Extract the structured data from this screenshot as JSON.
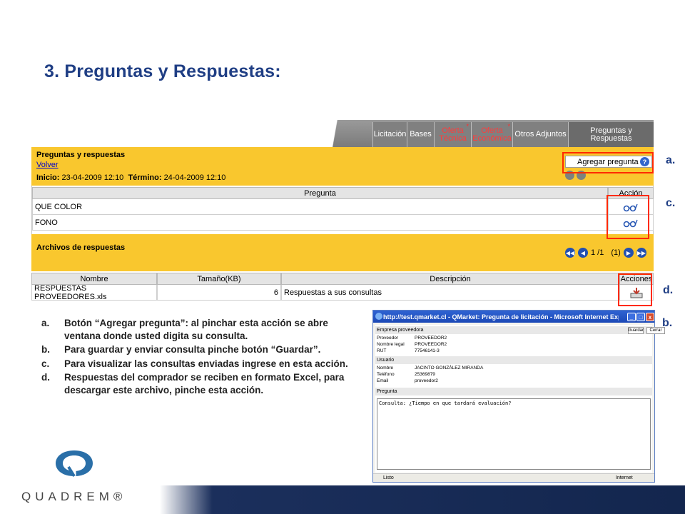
{
  "slide": {
    "title": "3.  Preguntas y Respuestas:"
  },
  "tabs": [
    {
      "label": "Licitación",
      "color": "white"
    },
    {
      "label": "Bases",
      "color": "white"
    },
    {
      "label": "Oferta Técnica",
      "color": "red"
    },
    {
      "label": "Oferta Económica",
      "color": "red"
    },
    {
      "label": "Otros Adjuntos",
      "color": "white"
    },
    {
      "label": "Preguntas y Respuestas",
      "color": "white"
    }
  ],
  "panel": {
    "title": "Preguntas y respuestas",
    "back_link": "Volver",
    "start_label": "Inicio:",
    "start_value": "23-04-2009 12:10",
    "end_label": "Término:",
    "end_value": "24-04-2009 12:10",
    "add_button": "Agregar pregunta",
    "help_icon": "?"
  },
  "questions_table": {
    "headers": [
      "Pregunta",
      "Acción"
    ],
    "rows": [
      {
        "question": "QUE COLOR"
      },
      {
        "question": "FONO"
      }
    ]
  },
  "files_panel": {
    "title": "Archivos de respuestas",
    "pager_text": "1 /1",
    "pager_count": "(1)"
  },
  "files_table": {
    "headers": [
      "Nombre",
      "Tamaño(KB)",
      "Descripción",
      "Acciones"
    ],
    "rows": [
      {
        "name": "RESPUESTAS PROVEEDORES.xls",
        "size": "6",
        "description": "Respuestas a sus consultas"
      }
    ]
  },
  "callouts": {
    "a": "a.",
    "c": "c.",
    "d": "d.",
    "b": "b."
  },
  "instructions": [
    {
      "label": "a.",
      "text": "Botón “Agregar pregunta”: al pinchar esta acción se abre ventana donde usted digita su consulta."
    },
    {
      "label": "b.",
      "text": "Para guardar y enviar consulta pinche botón “Guardar”."
    },
    {
      "label": "c.",
      "text": "Para visualizar las consultas enviadas ingrese en esta acción."
    },
    {
      "label": "d.",
      "text": "Respuestas del comprador se reciben en formato Excel, para descargar este archivo, pinche esta acción."
    }
  ],
  "popup": {
    "title": "http://test.qmarket.cl - QMarket: Pregunta de licitación - Microsoft Internet Explorer",
    "section_supplier": "Empresa proveedora",
    "guardar_button": "Guardar",
    "cerrar_button": "Cerrar",
    "supplier_rows": [
      {
        "key": "Proveedor",
        "value": "PROVEEDOR2"
      },
      {
        "key": "Nombre legal",
        "value": "PROVEEDOR2"
      },
      {
        "key": "RUT",
        "value": "77546141-3"
      }
    ],
    "section_user": "Usuario",
    "user_rows": [
      {
        "key": "Nombre",
        "value": "JACINTO GONZÁLEZ MIRANDA"
      },
      {
        "key": "Teléfono",
        "value": "25369879"
      },
      {
        "key": "Email",
        "value": "proveedor2"
      }
    ],
    "section_question": "Pregunta",
    "question_text": "Consulta: ¿Tiempo en que tardará evaluación?",
    "status_left": "Listo",
    "status_right": "Internet"
  },
  "brand": {
    "logo_text": "QUADREM®"
  },
  "colors": {
    "title_blue": "#1f3e84",
    "panel_yellow": "#f9c72e",
    "highlight_red": "#ff2a00",
    "tab_gray": "#808080"
  }
}
